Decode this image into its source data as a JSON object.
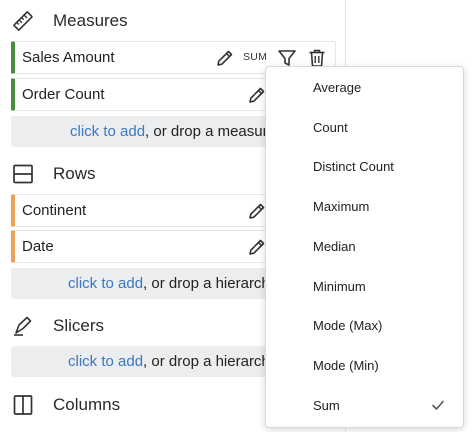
{
  "sections": {
    "measures": {
      "title": "Measures",
      "icon": "ruler-icon",
      "fields": [
        {
          "label": "Sales Amount",
          "aggregation": "SUM"
        },
        {
          "label": "Order Count"
        }
      ],
      "dropzone": {
        "link": "click to add",
        "rest": ", or drop a measure"
      }
    },
    "rows": {
      "title": "Rows",
      "icon": "rows-icon",
      "fields": [
        {
          "label": "Continent"
        },
        {
          "label": "Date"
        }
      ],
      "dropzone": {
        "link": "click to add",
        "rest": ", or drop a hierarchy"
      }
    },
    "slicers": {
      "title": "Slicers",
      "icon": "slicer-icon",
      "dropzone": {
        "link": "click to add",
        "rest": ", or drop a hierarchy"
      }
    },
    "columns": {
      "title": "Columns",
      "icon": "columns-icon"
    }
  },
  "aggregation_menu": {
    "items": [
      "Average",
      "Count",
      "Distinct Count",
      "Maximum",
      "Median",
      "Minimum",
      "Mode (Max)",
      "Mode (Min)",
      "Sum"
    ],
    "selected": "Sum"
  },
  "colors": {
    "measure_accent": "#4a8c3f",
    "dimension_accent": "#e8a25a",
    "link": "#3a78c2",
    "dropzone_bg": "#ecedef"
  }
}
